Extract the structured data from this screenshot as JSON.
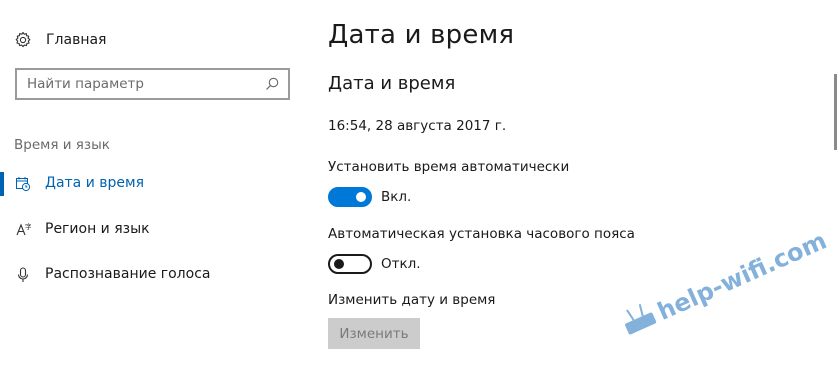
{
  "sidebar": {
    "home_label": "Главная",
    "search_placeholder": "Найти параметр",
    "section_label": "Время и язык",
    "items": [
      {
        "label": "Дата и время",
        "icon": "calendar-clock-icon",
        "active": true
      },
      {
        "label": "Регион и язык",
        "icon": "language-icon",
        "active": false
      },
      {
        "label": "Распознавание голоса",
        "icon": "microphone-icon",
        "active": false
      }
    ]
  },
  "main": {
    "page_title": "Дата и время",
    "section_title": "Дата и время",
    "current_datetime": "16:54, 28 августа 2017 г.",
    "auto_time": {
      "label": "Установить время автоматически",
      "state_text": "Вкл.",
      "on": true
    },
    "auto_timezone": {
      "label": "Автоматическая установка часового пояса",
      "state_text": "Откл.",
      "on": false
    },
    "change": {
      "label": "Изменить дату и время",
      "button_label": "Изменить"
    }
  },
  "watermark": {
    "text": "help-wifi.com"
  },
  "colors": {
    "accent": "#0078d7",
    "active_text": "#0063b1",
    "disabled_button": "#cccccc",
    "watermark": "#1e73be"
  }
}
